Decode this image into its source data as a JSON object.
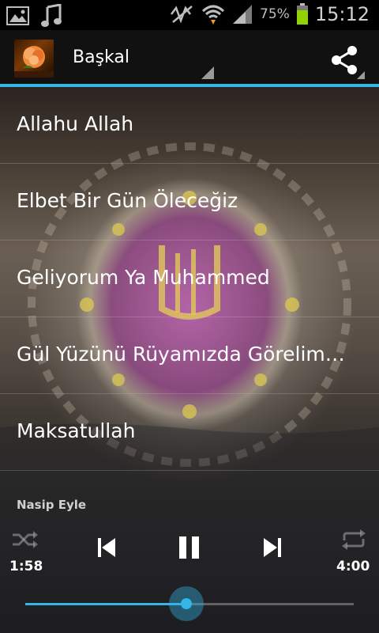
{
  "status_bar": {
    "battery_percent_label": "75%",
    "time": "15:12",
    "icons": [
      "image-icon",
      "music-note-icon",
      "mute-icon",
      "wifi-icon",
      "signal-icon",
      "battery-icon"
    ]
  },
  "action_bar": {
    "title": "Başkal",
    "logo_icon": "flower-logo-icon",
    "share_icon": "share-icon",
    "accent_color": "#33b5e5"
  },
  "list": {
    "items": [
      {
        "label": "Allahu Allah"
      },
      {
        "label": "Elbet Bir Gün Öleceğiz"
      },
      {
        "label": "Geliyorum Ya Muhammed"
      },
      {
        "label": "Gül Yüzünü Rüyamızda Görelim…"
      },
      {
        "label": "Maksatullah"
      }
    ]
  },
  "player": {
    "now_playing": "Nasip Eyle",
    "elapsed": "1:58",
    "total": "4:00",
    "progress_fraction": 0.49,
    "icons": [
      "shuffle-icon",
      "previous-icon",
      "pause-icon",
      "next-icon",
      "repeat-icon"
    ]
  }
}
